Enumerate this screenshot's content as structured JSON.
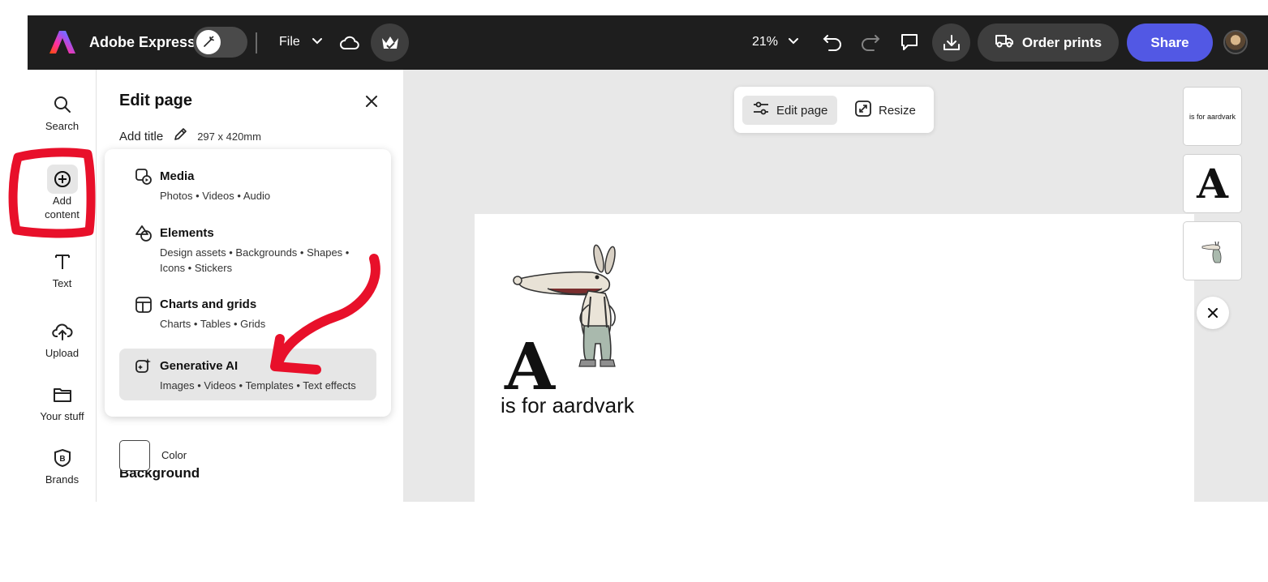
{
  "topbar": {
    "app_name": "Adobe Express",
    "file_label": "File",
    "zoom_label": "21%",
    "order_prints_label": "Order prints",
    "share_label": "Share"
  },
  "rail": {
    "items": [
      {
        "label": "Search",
        "icon": "search-icon"
      },
      {
        "label": "Add content",
        "icon": "plus-circle-icon"
      },
      {
        "label": "Text",
        "icon": "text-icon"
      },
      {
        "label": "Upload",
        "icon": "upload-cloud-icon"
      },
      {
        "label": "Your stuff",
        "icon": "folder-icon"
      },
      {
        "label": "Brands",
        "icon": "brand-icon"
      }
    ]
  },
  "panel": {
    "title": "Edit page",
    "add_title": "Add title",
    "size": "297 x 420mm",
    "background_heading": "Background",
    "color_label": "Color",
    "swatch_color": "#ffffff"
  },
  "menu": {
    "items": [
      {
        "title": "Media",
        "subtitle": "Photos • Videos • Audio",
        "icon": "media-icon"
      },
      {
        "title": "Elements",
        "subtitle": "Design assets • Backgrounds • Shapes • Icons • Stickers",
        "icon": "elements-icon"
      },
      {
        "title": "Charts and grids",
        "subtitle": "Charts • Tables • Grids",
        "icon": "grid-icon"
      },
      {
        "title": "Generative AI",
        "subtitle": "Images • Videos • Templates • Text effects",
        "icon": "sparkle-icon"
      }
    ]
  },
  "popup": {
    "edit_page_label": "Edit page",
    "resize_label": "Resize"
  },
  "canvas": {
    "big_letter": "A",
    "caption": "is for aardvark"
  },
  "thumbnails": {
    "items": [
      {
        "text": "is for aardvark"
      },
      {
        "text": "A"
      },
      {
        "text": ""
      }
    ]
  },
  "colors": {
    "topbar_bg": "#1e1e1e",
    "share_accent": "#5258e4",
    "annotation_red": "#e8102a"
  }
}
